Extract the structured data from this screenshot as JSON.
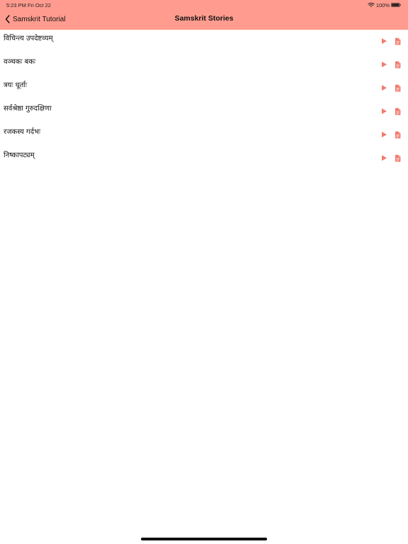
{
  "status_bar": {
    "time_date": "5:23 PM   Fri Oct 22",
    "battery": "100%",
    "icons": [
      "wifi-icon",
      "battery-icon"
    ]
  },
  "nav": {
    "back_label": "Samskrit Tutorial",
    "title": "Samskrit Stories"
  },
  "stories": [
    {
      "title": "विचिन्त्य उपदेष्टव्यम्"
    },
    {
      "title": "वञ्चकः बकः"
    },
    {
      "title": "त्रयः धूर्ताः"
    },
    {
      "title": "सर्वश्रेष्ठा गुरुदक्षिणा"
    },
    {
      "title": "रजकस्य गर्दभः"
    },
    {
      "title": "निष्कापट्यम्"
    }
  ],
  "row_icons": [
    "play-icon",
    "document-icon"
  ],
  "colors": {
    "header_background": "#ff9c8f",
    "accent": "#f17b6e",
    "text": "#111111"
  }
}
